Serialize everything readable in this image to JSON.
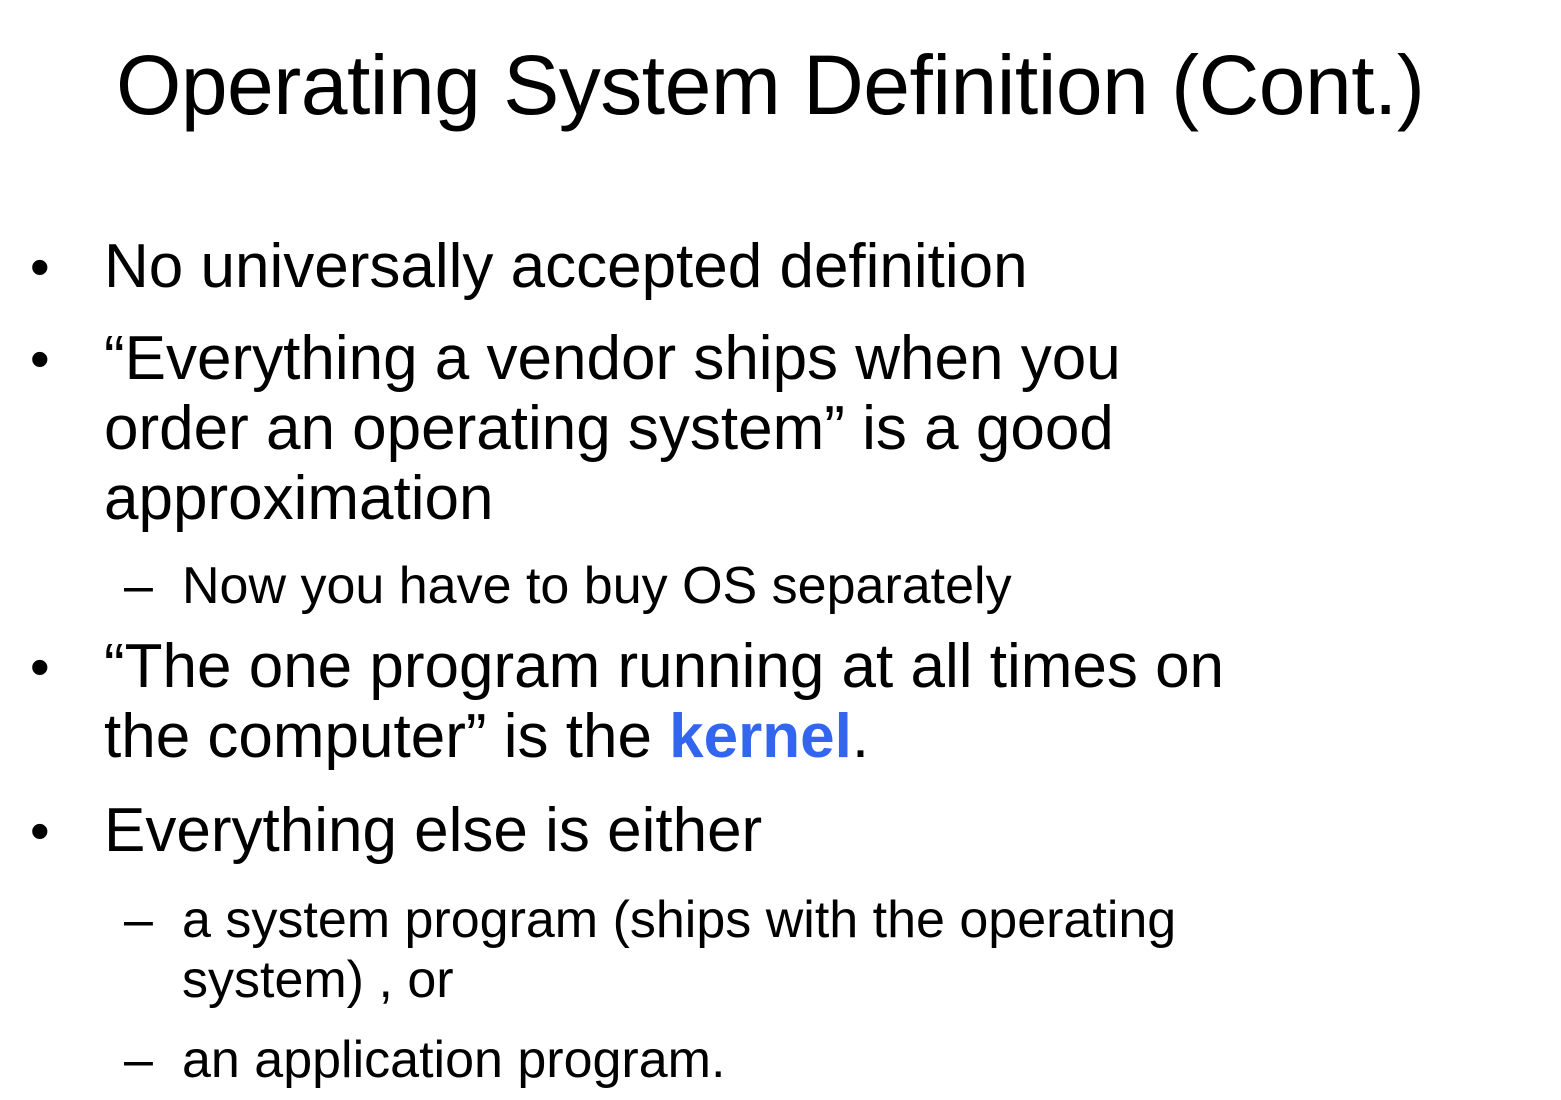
{
  "slide": {
    "title": "Operating System Definition (Cont.)",
    "bullet_glyph": "•",
    "dash_glyph": "–",
    "items": [
      {
        "text": "No universally accepted definition"
      },
      {
        "open_quote": "“",
        "quoted": "Everything a vendor ships when you order an operating system",
        "close_quote": "”",
        "rest": " is a good approximation",
        "sub": [
          "Now you have to buy OS separately"
        ]
      },
      {
        "open_quote": "“",
        "quoted": "The one program running at all times on the computer",
        "close_quote": "”",
        "rest": " is the ",
        "highlight": "kernel",
        "tail": "."
      },
      {
        "text": "Everything else is either",
        "sub": [
          "a system program (ships with the operating system) , or",
          "an application program."
        ]
      }
    ]
  },
  "colors": {
    "highlight": "#3366ee",
    "text": "#000000",
    "background": "#ffffff"
  }
}
